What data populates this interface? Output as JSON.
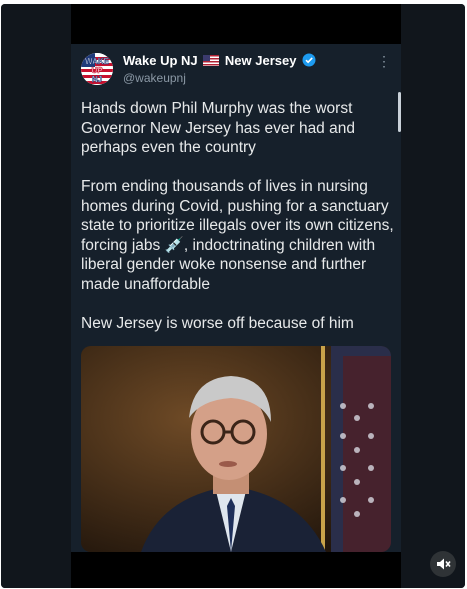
{
  "tweet": {
    "display_name_prefix": "Wake Up NJ",
    "display_name_suffix": "New Jersey",
    "handle": "@wakeupnj",
    "avatar_text_top": "WAKE",
    "avatar_text_mid": "UP",
    "avatar_text_bottom": "NJ",
    "paragraphs": [
      "Hands down Phil Murphy was the worst Governor New Jersey has ever had and perhaps even the country",
      "From ending thousands of lives in nursing homes during Covid, pushing for a sanctuary state to prioritize illegals over its own citizens, forcing jabs 💉, indoctrinating children with liberal gender woke nonsense and further made unaffordable",
      "New Jersey is worse off because of him"
    ],
    "more_icon": "more-vertical-icon",
    "verified_icon": "verified-badge-icon"
  },
  "colors": {
    "background": "#10151b",
    "card": "#16202b",
    "text": "#e7e9ea",
    "muted": "#8b98a5",
    "verified": "#1d9bf0"
  },
  "controls": {
    "mute_icon": "muted-speaker-icon"
  }
}
